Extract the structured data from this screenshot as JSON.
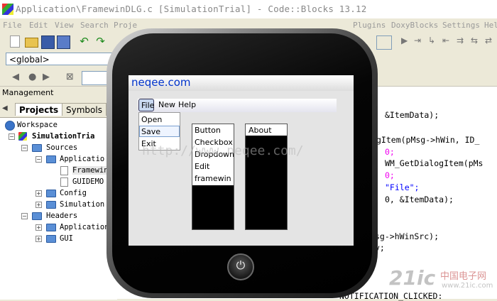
{
  "window": {
    "title": "Application\\FramewinDLG.c [SimulationTrial] - Code::Blocks 13.12"
  },
  "menu": [
    "File",
    "Edit",
    "View",
    "Search",
    "Proje",
    "Plugins",
    "DoxyBlocks",
    "Settings",
    "Hel"
  ],
  "scope_combo": "<global>",
  "management": {
    "label": "Management",
    "tabs": [
      "Projects",
      "Symbols"
    ],
    "tree": [
      {
        "label": "Workspace"
      },
      {
        "label": "SimulationTria"
      },
      {
        "label": "Sources"
      },
      {
        "label": "Applicatio"
      },
      {
        "label": "Framewin"
      },
      {
        "label": "GUIDEMO"
      },
      {
        "label": "Config"
      },
      {
        "label": "Simulation"
      },
      {
        "label": "Headers"
      },
      {
        "label": "Application"
      },
      {
        "label": "GUI"
      }
    ]
  },
  "code": {
    "l1": "&ItemData);",
    "l2a": "gItem(pMsg->hWin, ID_",
    "l3": "0;",
    "l4": "WM_GetDialogItem(pMs",
    "l5": "0;",
    "l6": "\"File\";",
    "l7": "0, &ItemData);",
    "l8": "sg->hWinSrc);",
    "l9": "v;",
    "l10": "NOTIFICATION_CLICKED:"
  },
  "watermark": "http://www.neqee.com/",
  "brand": {
    "logo": "21ic",
    "cn": "中国电子网",
    "url": "www.21ic.com"
  },
  "phone": {
    "frame_title": "neqee.com",
    "menu": [
      "File",
      "New",
      "Help"
    ],
    "file_dropdown": [
      "Open",
      "Save",
      "Exit"
    ],
    "listbox1": [
      "Button",
      "Checkbox",
      "Dropdown",
      "Edit",
      "framewin"
    ],
    "listbox2": [
      "About"
    ]
  },
  "colors": {
    "frame_title": "#0033cc",
    "xp_bg": "#ece9d8"
  }
}
